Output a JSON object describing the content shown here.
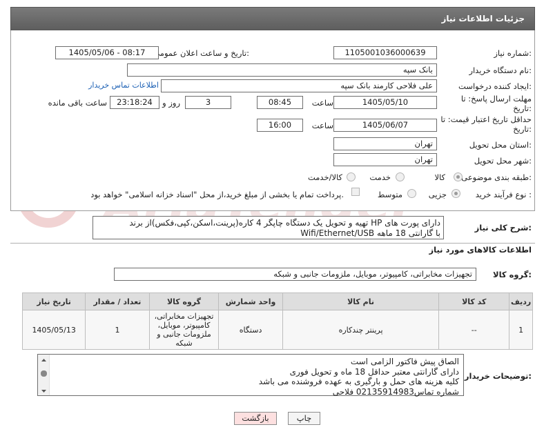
{
  "header": {
    "title": "جزئیات اطلاعات نیاز"
  },
  "form": {
    "need_number_label": "شماره نیاز:",
    "need_number": "1105001036000639",
    "announce_label": "تاریخ و ساعت اعلان عمومی:",
    "announce_value": "1405/05/06 - 08:17",
    "buyer_org_label": "نام دستگاه خریدار:",
    "buyer_org": "بانک سپه",
    "requester_label": "ایجاد کننده درخواست:",
    "requester": "علی فلاحی کارمند بانک سپه",
    "buyer_contact_link": "اطلاعات تماس خریدار",
    "deadline_label": "مهلت ارسال پاسخ: تا تاریخ:",
    "deadline_date": "1405/05/10",
    "time_label": "ساعت",
    "deadline_time": "08:45",
    "days_value": "3",
    "days_label": "روز و",
    "remaining_time": "23:18:24",
    "remaining_label": "ساعت باقی مانده",
    "price_validity_label": "حداقل تاریخ اعتبار قیمت: تا تاریخ:",
    "price_validity_date": "1405/06/07",
    "price_validity_time": "16:00",
    "province_label": "استان محل تحویل:",
    "province": "تهران",
    "city_label": "شهر محل تحویل:",
    "city": "تهران",
    "category_label": "طبقه بندی موضوعی:",
    "category_options": [
      "کالا",
      "خدمت",
      "کالا/خدمت"
    ],
    "category_selected": "کالا",
    "process_label": "نوع فرآیند خرید :",
    "process_options": [
      "جزیی",
      "متوسط"
    ],
    "process_selected": "جزیی",
    "payment_note": "پرداخت تمام یا بخشی از مبلغ خرید،از محل \"اسناد خزانه اسلامی\" خواهد بود."
  },
  "description": {
    "label": "شرح کلی نیاز:",
    "text": "تهیه و تحویل یک دستگاه چاپگر 4 کاره(پرینت،اسکن،کپی،فکس)از برند HP دارای پورت های Wifi/Ethernet/USB با گارانتی 18 ماهه"
  },
  "goods": {
    "section_title": "اطلاعات کالاهای مورد نیاز",
    "group_label": "گروه کالا:",
    "group_value": "تجهیزات مخابراتی، کامپیوتر، موبایل، ملزومات جانبی و شبکه",
    "columns": [
      "ردیف",
      "کد کالا",
      "نام کالا",
      "واحد شمارش",
      "گروه کالا",
      "تعداد / مقدار",
      "تاریخ نیاز"
    ],
    "rows": [
      {
        "index": "1",
        "code": "--",
        "name": "پرینتر چندکاره",
        "unit": "دستگاه",
        "group": "تجهیزات مخابراتی، کامپیوتر، موبایل، ملزومات جانبی و شبکه",
        "qty": "1",
        "date": "1405/05/13"
      }
    ]
  },
  "notes": {
    "label": "توضیحات خریدار:",
    "lines": [
      "الصاق پیش فاکتور الزامی است",
      "دارای گارانتی معتبر حداقل 18 ماه و تحویل فوری",
      "کلیه هزینه های حمل و بارگیری به عهده فروشنده می باشد",
      "شماره تماس02135914983 فلاحی"
    ]
  },
  "buttons": {
    "print": "چاپ",
    "back": "بازگشت"
  },
  "watermark": {
    "text": "AriaTender.net"
  },
  "colors": {
    "header_bg": "#6b6b6b",
    "link": "#1a5fb4",
    "back_button_bg": "#fde0e0"
  }
}
